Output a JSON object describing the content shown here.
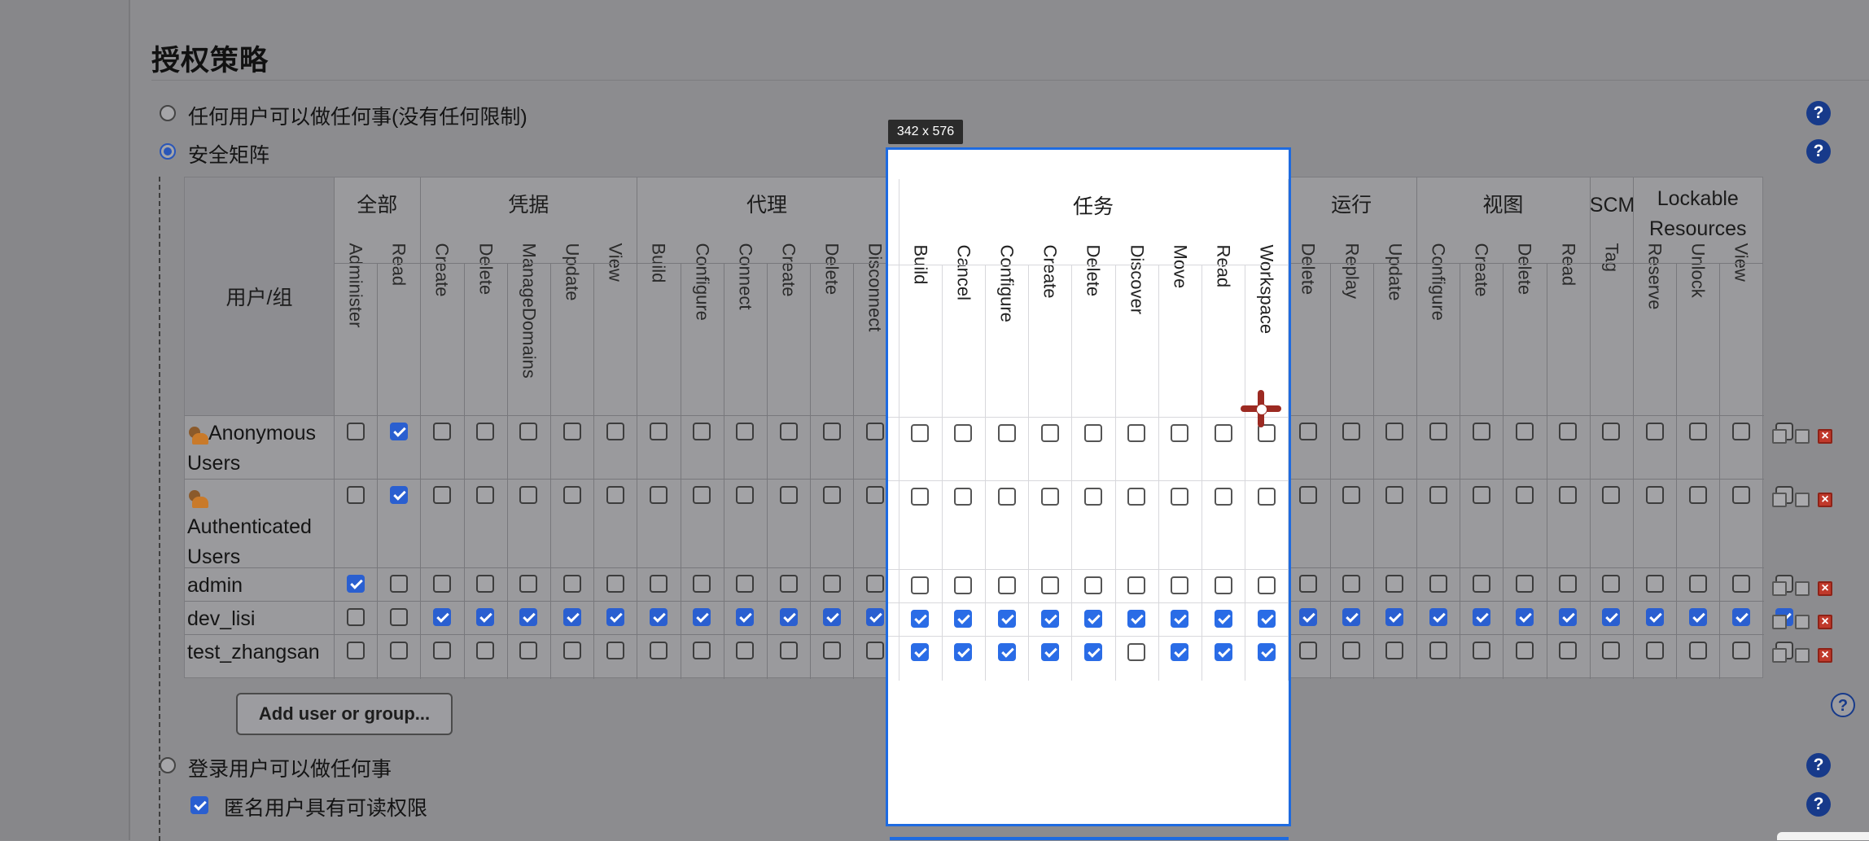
{
  "section_title": "授权策略",
  "options": {
    "anyone": "任何用户可以做任何事(没有任何限制)",
    "matrix": "安全矩阵",
    "logged_in": "登录用户可以做任何事",
    "anon_read": "匿名用户具有可读权限"
  },
  "help_icon_text": "?",
  "matrix": {
    "user_header": "用户/组",
    "groups": [
      {
        "name": "全部",
        "permissions": [
          "Administer",
          "Read"
        ]
      },
      {
        "name": "凭据",
        "permissions": [
          "Create",
          "Delete",
          "ManageDomains",
          "Update",
          "View"
        ]
      },
      {
        "name": "代理",
        "permissions": [
          "Build",
          "Configure",
          "Connect",
          "Create",
          "Delete",
          "Disconnect"
        ]
      },
      {
        "name": "任务",
        "permissions": [
          "Build",
          "Cancel",
          "Configure",
          "Create",
          "Delete",
          "Discover",
          "Move",
          "Read",
          "Workspace"
        ]
      },
      {
        "name": "运行",
        "permissions": [
          "Delete",
          "Replay",
          "Update"
        ]
      },
      {
        "name": "视图",
        "permissions": [
          "Configure",
          "Create",
          "Delete",
          "Read"
        ]
      },
      {
        "name": "SCM",
        "permissions": [
          "Tag"
        ]
      },
      {
        "name": "Lockable Resources",
        "permissions": [
          "Reserve",
          "Unlock",
          "View"
        ]
      }
    ],
    "rows": [
      {
        "name": "Anonymous Users",
        "icon": "user-group-icon",
        "checked": [
          0,
          1,
          0,
          0,
          0,
          0,
          0,
          0,
          0,
          0,
          0,
          0,
          0,
          0,
          0,
          0,
          0,
          0,
          0,
          0,
          0,
          0,
          0,
          0,
          0,
          0,
          0,
          0,
          0,
          0,
          0,
          0,
          0,
          0
        ]
      },
      {
        "name": "Authenticated Users",
        "icon": "user-group-icon",
        "checked": [
          0,
          1,
          0,
          0,
          0,
          0,
          0,
          0,
          0,
          0,
          0,
          0,
          0,
          0,
          0,
          0,
          0,
          0,
          0,
          0,
          0,
          0,
          0,
          0,
          0,
          0,
          0,
          0,
          0,
          0,
          0,
          0,
          0,
          0
        ]
      },
      {
        "name": "admin",
        "icon": "",
        "checked": [
          1,
          0,
          0,
          0,
          0,
          0,
          0,
          0,
          0,
          0,
          0,
          0,
          0,
          0,
          0,
          0,
          0,
          0,
          0,
          0,
          0,
          0,
          0,
          0,
          0,
          0,
          0,
          0,
          0,
          0,
          0,
          0,
          0,
          0
        ]
      },
      {
        "name": "dev_lisi",
        "icon": "",
        "checked": [
          0,
          0,
          1,
          1,
          1,
          1,
          1,
          1,
          1,
          1,
          1,
          1,
          1,
          1,
          1,
          1,
          1,
          1,
          1,
          1,
          1,
          1,
          1,
          1,
          1,
          1,
          1,
          1,
          1,
          1,
          1,
          1,
          1,
          1
        ]
      },
      {
        "name": "test_zhangsan",
        "icon": "",
        "checked": [
          0,
          0,
          0,
          0,
          0,
          0,
          0,
          0,
          0,
          0,
          0,
          0,
          0,
          1,
          1,
          1,
          1,
          1,
          0,
          1,
          1,
          1,
          0,
          0,
          0,
          0,
          0,
          0,
          0,
          0,
          0,
          0,
          0,
          0
        ]
      }
    ]
  },
  "add_button": "Add user or group...",
  "selection_size": "342 x 576",
  "row_action_icons": [
    "copy-icon",
    "duplicate-icon",
    "delete-icon"
  ]
}
